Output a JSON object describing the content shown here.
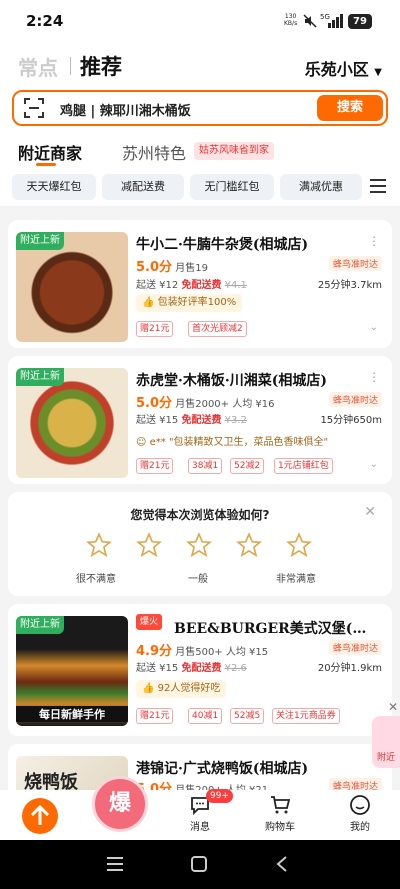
{
  "status_bar": {
    "time": "2:24",
    "net_speed": "130",
    "net_unit": "KB/s",
    "network": "5G",
    "battery": "79"
  },
  "header": {
    "tab_nearby": "常点",
    "tab_recommend": "推荐",
    "location": "乐苑小区"
  },
  "search": {
    "query": "鸡腿 | 辣耶川湘木桶饭",
    "button": "搜索"
  },
  "category_tabs": {
    "nearby": "附近商家",
    "suzhou": "苏州特色",
    "promo": "姑苏风味省到家"
  },
  "filters": [
    "天天爆红包",
    "减配送费",
    "无门槛红包",
    "满减优惠"
  ],
  "stores": [
    {
      "tag": "附近上新",
      "name": "牛小二·牛腩牛杂煲(相城店)",
      "rating": "5.0分",
      "monthly_sales": "月售19",
      "avg_price": "",
      "min_order": "起送 ¥12",
      "delivery": "免配送费",
      "old_fee": "¥4.1",
      "badge": "蜂鸟准时达",
      "eta": "25分钟3.7km",
      "highlight": "包装好评率100%",
      "coupons": [
        "赠21元",
        "首次光顾减2"
      ]
    },
    {
      "tag": "附近上新",
      "name": "赤虎堂·木桶饭·川湘菜(相城店)",
      "rating": "5.0分",
      "monthly_sales": "月售2000+",
      "avg_price": "人均 ¥16",
      "min_order": "起送 ¥15",
      "delivery": "免配送费",
      "old_fee": "¥3.2",
      "badge": "蜂鸟准时达",
      "eta": "15分钟650m",
      "highlight": "e** \"包装精致又卫生，菜品色香味俱全\"",
      "coupons": [
        "赠21元",
        "38减1",
        "52减2",
        "1元店铺红包"
      ]
    },
    {
      "tag": "附近上新",
      "hot": "爆火",
      "name": "BEE&BURGER美式汉堡(…",
      "rating": "4.9分",
      "monthly_sales": "月售500+",
      "avg_price": "人均 ¥15",
      "min_order": "起送 ¥15",
      "delivery": "免配送费",
      "old_fee": "¥2.6",
      "badge": "蜂鸟准时达",
      "eta": "20分钟1.9km",
      "highlight": "92人觉得好吃",
      "coupons": [
        "赠21元",
        "40减1",
        "52减5",
        "关注1元商品券"
      ],
      "image_text": "每日新鲜手作"
    },
    {
      "tag": "",
      "name": "港锦记·广式烧鸭饭(相城店)",
      "rating": "5.0分",
      "monthly_sales": "月售200+",
      "avg_price": "人均 ¥21",
      "badge": "蜂鸟准时达",
      "image_text": "烧鸭饭"
    }
  ],
  "survey": {
    "question": "您觉得本次浏览体验如何?",
    "labels": [
      "很不满意",
      "一般",
      "非常满意"
    ]
  },
  "float_ad": {
    "label": "附近"
  },
  "bottom_nav": {
    "hot": "爆",
    "messages": "消息",
    "badge": "99+",
    "cart": "购物车",
    "mine": "我的"
  }
}
